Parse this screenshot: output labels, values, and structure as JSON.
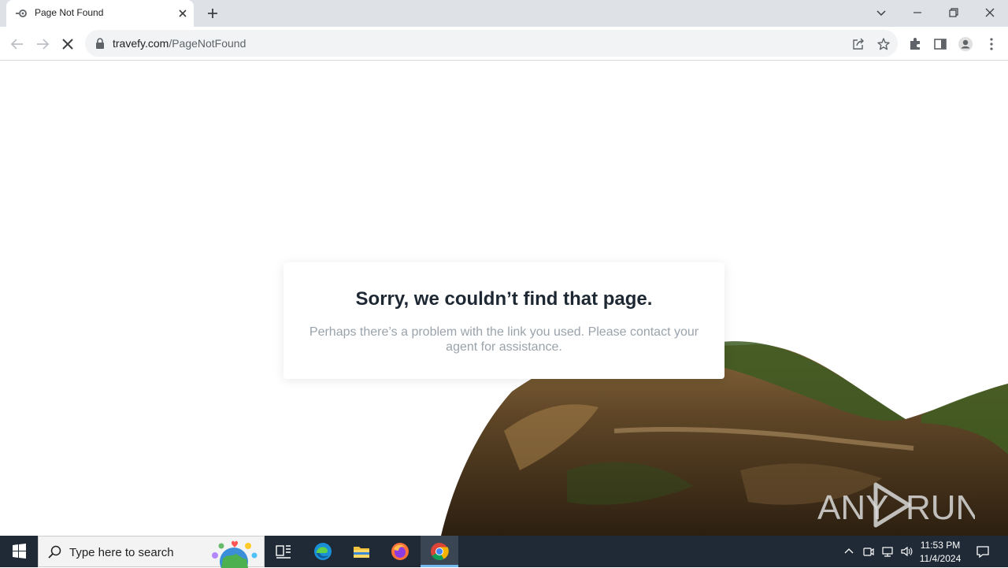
{
  "browser": {
    "tab": {
      "title": "Page Not Found"
    },
    "address": {
      "domain": "travefy.com",
      "path": "/PageNotFound"
    }
  },
  "page": {
    "heading": "Sorry, we couldn’t find that page.",
    "message": "Perhaps there’s a problem with the link you used. Please contact your agent for assistance."
  },
  "watermark": {
    "left": "ANY",
    "right": "RUN"
  },
  "taskbar": {
    "search_placeholder": "Type here to search",
    "apps": [
      {
        "name": "Task View",
        "icon": "task-view-icon"
      },
      {
        "name": "Microsoft Edge",
        "icon": "edge-icon"
      },
      {
        "name": "File Explorer",
        "icon": "folder-icon"
      },
      {
        "name": "Firefox",
        "icon": "firefox-icon"
      },
      {
        "name": "Google Chrome",
        "icon": "chrome-icon",
        "active": true
      }
    ],
    "clock": {
      "time": "11:53 PM",
      "date": "11/4/2024"
    }
  },
  "colors": {
    "heading": "#1d2833",
    "message": "#9aa3ab",
    "tabbar": "#dee1e6",
    "taskbar": "#1f2a36"
  }
}
